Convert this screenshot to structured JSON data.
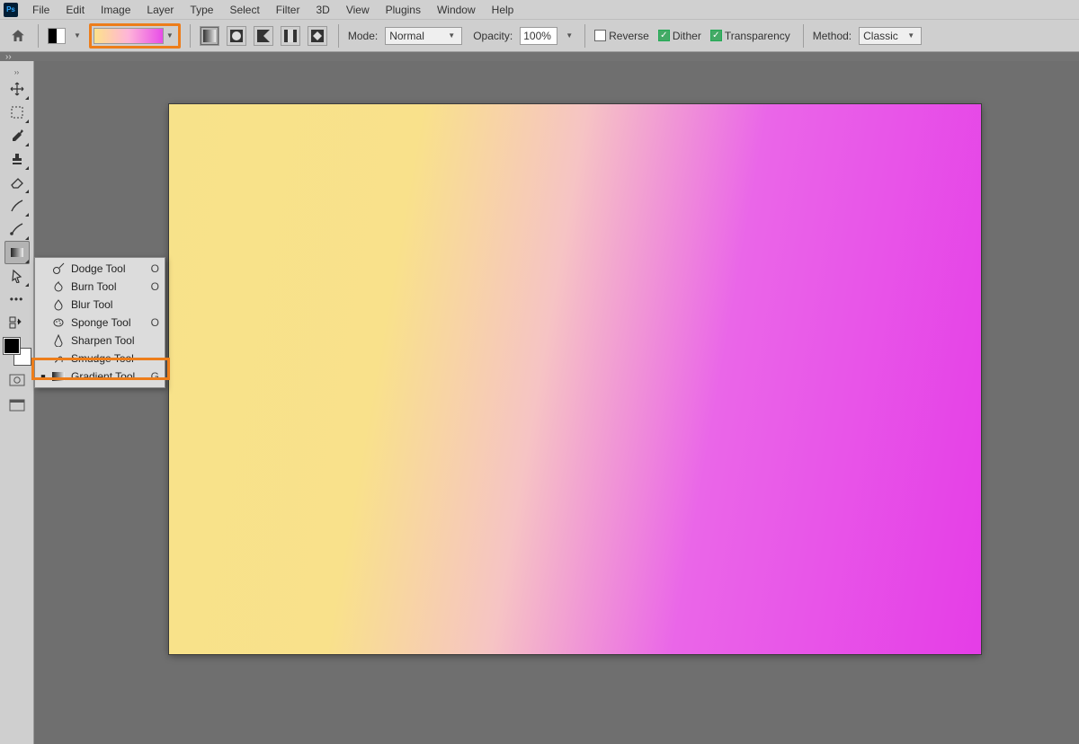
{
  "menu": [
    "File",
    "Edit",
    "Image",
    "Layer",
    "Type",
    "Select",
    "Filter",
    "3D",
    "View",
    "Plugins",
    "Window",
    "Help"
  ],
  "opt": {
    "mode_label": "Mode:",
    "mode_value": "Normal",
    "opacity_label": "Opacity:",
    "opacity_value": "100%",
    "reverse": "Reverse",
    "dither": "Dither",
    "transparency": "Transparency",
    "method_label": "Method:",
    "method_value": "Classic"
  },
  "tabstrip": "››",
  "flyout": {
    "items": [
      {
        "name": "Dodge Tool",
        "shortcut": "O"
      },
      {
        "name": "Burn Tool",
        "shortcut": "O"
      },
      {
        "name": "Blur Tool",
        "shortcut": ""
      },
      {
        "name": "Sponge Tool",
        "shortcut": "O"
      },
      {
        "name": "Sharpen Tool",
        "shortcut": ""
      },
      {
        "name": "Smudge Tool",
        "shortcut": ""
      },
      {
        "name": "Gradient Tool",
        "shortcut": "G"
      }
    ]
  },
  "highlight": {
    "gradient_picker": true,
    "flyout_index": 6
  },
  "colors": {
    "accent": "#ed7d1a"
  }
}
